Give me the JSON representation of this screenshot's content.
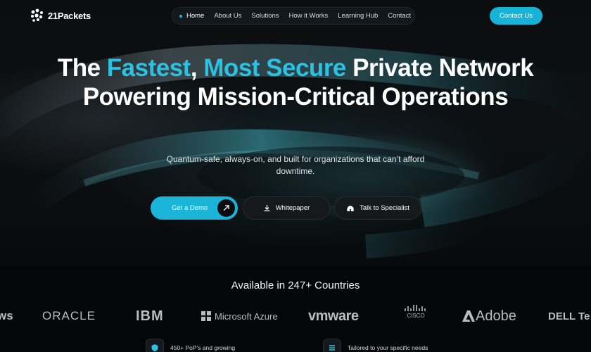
{
  "brand": {
    "name": "21Packets"
  },
  "nav": {
    "items": [
      {
        "label": "Home",
        "active": true
      },
      {
        "label": "About Us",
        "active": false
      },
      {
        "label": "Solutions",
        "active": false
      },
      {
        "label": "How it Works",
        "active": false
      },
      {
        "label": "Learning Hub",
        "active": false
      },
      {
        "label": "Contact",
        "active": false
      }
    ],
    "cta_label": "Contact Us"
  },
  "hero": {
    "headline_parts": [
      "The ",
      "Fastest",
      ", ",
      "Most Secure",
      " Private Network Powering Mission-Critical Operations"
    ],
    "subhead": "Quantum-safe, always-on, and built for organizations that can’t afford downtime.",
    "buttons": {
      "demo": "Get a Demo",
      "whitepaper": "Whitepaper",
      "specialist": "Talk to Specialist"
    }
  },
  "coverage": {
    "title": "Available in 247+ Countries"
  },
  "partners": {
    "logos": [
      "ws",
      "ORACLE",
      "IBM",
      "Microsoft Azure",
      "vmware",
      "CISCO",
      "Adobe",
      "DELL Te"
    ]
  },
  "features": [
    {
      "label": "450+ PoP's and growing",
      "icon": "shield-check-icon"
    },
    {
      "label": "Tailored to your specific needs",
      "icon": "sliders-icon"
    }
  ],
  "colors": {
    "accent": "#2bc1e2",
    "button": "#17b3d6",
    "background": "#050607"
  }
}
